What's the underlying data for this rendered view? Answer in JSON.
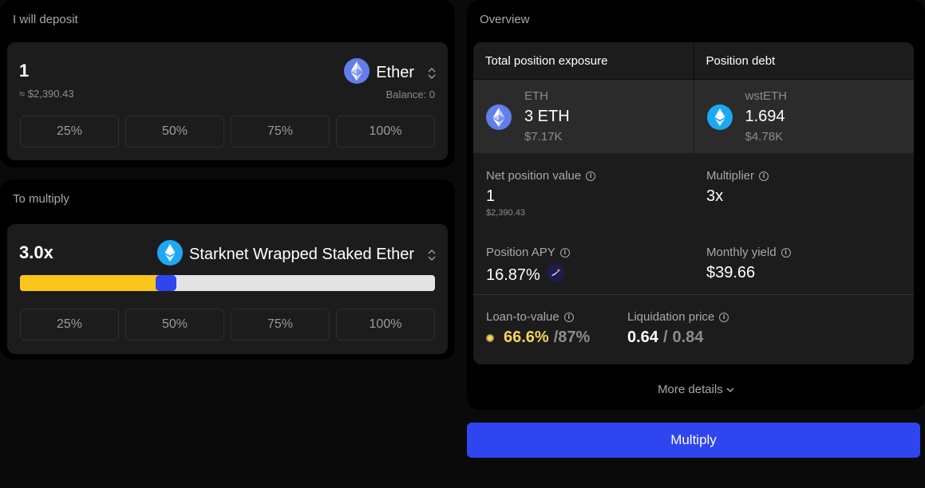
{
  "deposit": {
    "title": "I will deposit",
    "amount": "1",
    "usd_value": "≈ $2,390.43",
    "token": "Ether",
    "token_icon": "eth-icon",
    "balance": "Balance: 0",
    "percent_buttons": [
      "25%",
      "50%",
      "75%",
      "100%"
    ]
  },
  "multiply": {
    "title": "To multiply",
    "value": "3.0x",
    "token": "Starknet Wrapped Staked Ether",
    "token_icon": "wsteth-icon",
    "slider_level": 0.35,
    "percent_buttons": [
      "25%",
      "50%",
      "75%",
      "100%"
    ]
  },
  "overview": {
    "title": "Overview",
    "exposure_header": "Total position exposure",
    "debt_header": "Position debt",
    "exposure": {
      "symbol": "ETH",
      "amount": "3 ETH",
      "usd": "$7.17K"
    },
    "debt": {
      "symbol": "wstETH",
      "amount": "1.694",
      "usd": "$4.78K"
    },
    "net_value": {
      "label": "Net position value",
      "value": "1",
      "sub": "$2,390.43"
    },
    "multiplier": {
      "label": "Multiplier",
      "value": "3x"
    },
    "apy": {
      "label": "Position APY",
      "value": "16.87%"
    },
    "monthly_yield": {
      "label": "Monthly yield",
      "value": "$39.66"
    },
    "ltv": {
      "label": "Loan-to-value",
      "current": "66.6%",
      "max": "/87%"
    },
    "liquidation": {
      "label": "Liquidation price",
      "current": "0.64",
      "sep": "/",
      "max": "0.84"
    },
    "info_glyph": "i",
    "more_details": "More details"
  },
  "action_button": "Multiply",
  "colors": {
    "accent_blue": "#2f45ef",
    "slider_yellow": "#f9c71a",
    "ltv_yellow": "#f5d35b",
    "eth_purple": "#627eea",
    "wsteth_blue": "#1ea7f2"
  }
}
